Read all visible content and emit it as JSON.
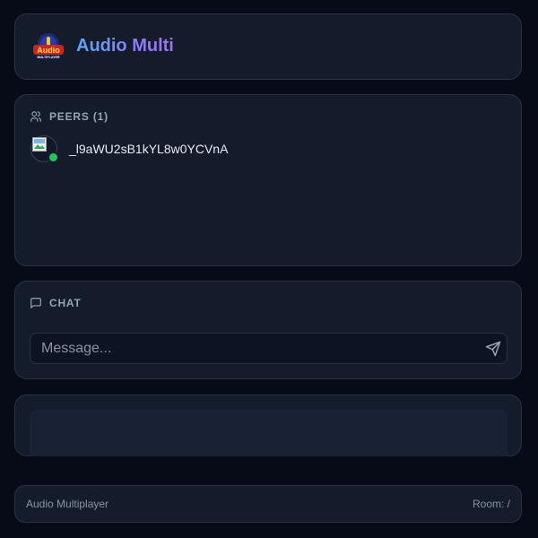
{
  "header": {
    "logo_text": "Audio",
    "logo_subtext": "MULTIPLAYER",
    "title": "Audio Multi"
  },
  "peers": {
    "heading": "PEERS (1)",
    "items": [
      {
        "name": "_l9aWU2sB1kYL8w0YCVnA",
        "status": "online"
      }
    ]
  },
  "chat": {
    "heading": "CHAT",
    "input_placeholder": "Message...",
    "input_value": ""
  },
  "footer": {
    "left": "Audio Multiplayer",
    "right": "Room: /"
  },
  "colors": {
    "background": "#070b17",
    "card": "#141c2c",
    "online": "#22c55e",
    "title_gradient_start": "#5aa8f5",
    "title_gradient_end": "#a06ff1"
  },
  "icons": {
    "peers": "users-icon",
    "chat": "message-square-icon",
    "send": "send-icon"
  }
}
